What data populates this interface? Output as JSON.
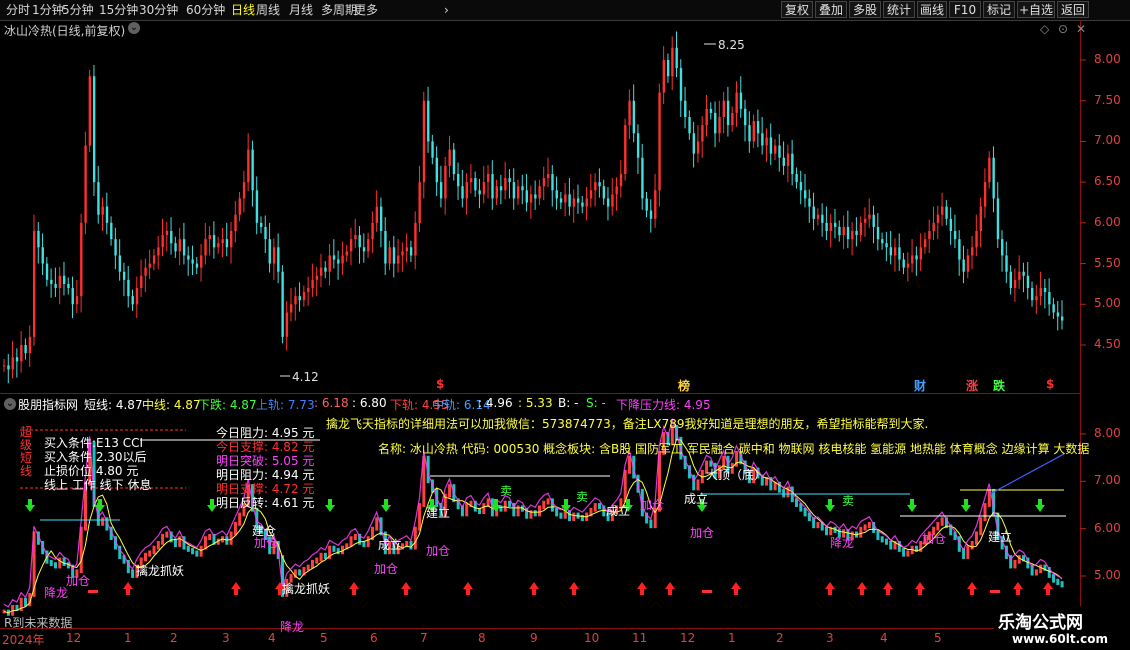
{
  "toolbar": {
    "periods": [
      "分时",
      "1分钟",
      "5分钟",
      "15分钟",
      "30分钟",
      "60分钟",
      "日线",
      "周线",
      "月线",
      "多周期",
      "更多"
    ],
    "active_period": "日线",
    "buttons": [
      "复权",
      "叠加",
      "多股",
      "统计",
      "画线",
      "F10",
      "标记",
      "+自选",
      "返回"
    ]
  },
  "main_pane": {
    "title": "冰山冷热(日线,前复权)",
    "high_label": "8.25",
    "low_label": "4.12",
    "y_ticks": [
      "8.00",
      "7.50",
      "7.00",
      "6.50",
      "6.00",
      "5.50",
      "5.00",
      "4.50"
    ],
    "event_markers": [
      {
        "text": "$",
        "color": "#ff3030"
      },
      {
        "text": "榜",
        "color": "#ffd040"
      },
      {
        "text": "财",
        "color": "#40a0ff"
      },
      {
        "text": "涨",
        "color": "#ff4040"
      },
      {
        "text": "跌",
        "color": "#40ff40"
      },
      {
        "text": "$",
        "color": "#ff3030"
      }
    ],
    "candles_close": [
      4.25,
      4.2,
      4.35,
      4.3,
      4.5,
      4.4,
      4.6,
      5.9,
      5.7,
      5.5,
      5.3,
      5.25,
      5.2,
      5.35,
      5.25,
      5.2,
      5.0,
      5.1,
      6.0,
      6.95,
      7.8,
      6.5,
      6.1,
      6.2,
      6.0,
      5.8,
      5.6,
      5.4,
      5.3,
      5.1,
      5.0,
      5.2,
      5.35,
      5.45,
      5.5,
      5.6,
      5.7,
      5.85,
      5.9,
      5.75,
      5.65,
      5.8,
      5.6,
      5.55,
      5.5,
      5.45,
      5.6,
      5.8,
      5.85,
      5.7,
      5.75,
      5.8,
      5.7,
      5.9,
      6.1,
      6.3,
      6.5,
      6.9,
      6.4,
      6.0,
      5.95,
      5.8,
      5.5,
      5.7,
      5.4,
      4.6,
      4.9,
      5.0,
      5.1,
      5.05,
      5.15,
      5.2,
      5.3,
      5.35,
      5.45,
      5.4,
      5.6,
      5.55,
      5.5,
      5.6,
      5.65,
      5.8,
      5.85,
      5.7,
      5.65,
      5.8,
      6.0,
      6.2,
      5.9,
      5.5,
      5.7,
      5.5,
      5.6,
      5.65,
      5.7,
      5.6,
      6.0,
      6.5,
      7.5,
      7.0,
      6.8,
      6.5,
      6.3,
      6.7,
      6.9,
      6.6,
      6.45,
      6.3,
      6.5,
      6.55,
      6.4,
      6.35,
      6.5,
      6.6,
      6.3,
      6.45,
      6.4,
      6.55,
      6.5,
      6.3,
      6.45,
      6.4,
      6.25,
      6.35,
      6.3,
      6.45,
      6.55,
      6.6,
      6.4,
      6.3,
      6.25,
      6.35,
      6.2,
      6.3,
      6.25,
      6.2,
      6.3,
      6.4,
      6.5,
      6.45,
      6.3,
      6.2,
      6.35,
      6.45,
      6.6,
      7.2,
      7.5,
      7.1,
      6.8,
      6.3,
      6.15,
      6.05,
      6.4,
      7.6,
      8.0,
      7.8,
      8.15,
      7.9,
      7.5,
      7.3,
      7.1,
      6.85,
      7.0,
      7.2,
      7.4,
      7.35,
      7.1,
      7.3,
      7.5,
      7.2,
      7.35,
      7.6,
      7.4,
      7.2,
      7.0,
      7.25,
      7.1,
      6.95,
      7.05,
      6.85,
      6.95,
      6.8,
      6.7,
      6.85,
      6.6,
      6.5,
      6.4,
      6.3,
      6.2,
      6.05,
      6.1,
      6.0,
      5.9,
      6.0,
      5.95,
      5.85,
      5.95,
      5.8,
      5.9,
      5.85,
      6.0,
      6.05,
      6.1,
      5.95,
      5.8,
      5.75,
      5.7,
      5.6,
      5.7,
      5.55,
      5.45,
      5.5,
      5.6,
      5.55,
      5.7,
      5.8,
      5.9,
      6.0,
      6.1,
      6.2,
      6.05,
      5.9,
      5.8,
      5.55,
      5.4,
      5.6,
      5.7,
      5.9,
      6.2,
      6.5,
      6.8,
      6.3,
      5.8,
      5.6,
      5.4,
      5.2,
      5.3,
      5.4,
      5.35,
      5.2,
      5.05,
      5.1,
      5.2,
      5.15,
      5.0,
      4.9,
      4.85,
      4.8
    ]
  },
  "indicator_pane": {
    "title": "股朋指标网",
    "legend": [
      {
        "text": "短线: 4.87",
        "color": "#ffffff"
      },
      {
        "text": "中线: 4.87",
        "color": "#ffff40"
      },
      {
        "text": "下跌: 4.87",
        "color": "#40ff40"
      },
      {
        "text": "上轨: 7.73",
        "color": "#4080ff"
      },
      {
        "text": ": 6.18",
        "color": "#ff6060"
      },
      {
        "text": ": 6.80",
        "color": "#ffffff"
      },
      {
        "text": "下轨: 4.55",
        "color": "#ff4040"
      },
      {
        "text": "中轨: 6.14",
        "color": "#40a0ff"
      },
      {
        "text": ": 4.96",
        "color": "#ffffff"
      },
      {
        "text": ": 5.33",
        "color": "#ffff40"
      },
      {
        "text": "B: -",
        "color": "#ffffff"
      },
      {
        "text": "S: -",
        "color": "#40ff40"
      },
      {
        "text": "下降压力线: 4.95",
        "color": "#ff40ff"
      }
    ],
    "y_ticks": [
      "8.00",
      "7.00",
      "6.00",
      "5.00"
    ],
    "promo_line": "擒龙飞天指标的详细用法可以加我微信：573874773，备注LX789我好知道是理想的朋友，希望指标能帮到大家.",
    "info_line": "名称: 冰山冷热 代码: 000530 概念板块: 含B股 国防军工 军民融合 碳中和 物联网 核电核能 氢能源 地热能 体育概念 边缘计算 大数据",
    "rules": [
      {
        "text": "买入条件:E13 CCI",
        "color": "#ffffff"
      },
      {
        "text": "买入条件 2.30以后",
        "color": "#ffffff"
      },
      {
        "text": "止损价位 4.80 元",
        "color": "#ffffff"
      },
      {
        "text": "线上 工作 线下 休息",
        "color": "#ffffff"
      }
    ],
    "levels": [
      {
        "text": "今日阻力: 4.95 元",
        "color": "#ffffff"
      },
      {
        "text": "今日支撑: 4.82 元",
        "color": "#ff3030"
      },
      {
        "text": "明日突破: 5.05 元",
        "color": "#ff40ff"
      },
      {
        "text": "明日阻力: 4.94 元",
        "color": "#ffffff"
      },
      {
        "text": "明日支撑: 4.72 元",
        "color": "#ff3030"
      },
      {
        "text": "明日反转: 4.61 元",
        "color": "#ffffff"
      }
    ],
    "side_text": "超级短线",
    "annotations": [
      "降龙",
      "加仓",
      "擒龙抓妖",
      "擒龙抓妖",
      "建仓",
      "加仓",
      "建立",
      "加仓",
      "成立",
      "加仓",
      "成立",
      "加仓",
      "大顶（底）",
      "成立",
      "加仓",
      "降龙",
      "卖",
      "卖",
      "卖",
      "加仓",
      "建立",
      "降龙"
    ],
    "footer": "R到未来数据"
  },
  "date_axis": {
    "labels": [
      "2024年",
      "12",
      "1",
      "2",
      "3",
      "4",
      "5",
      "6",
      "7",
      "8",
      "9",
      "10",
      "11",
      "12",
      "1",
      "2",
      "3",
      "4",
      "5"
    ]
  },
  "watermark": {
    "cn": "乐淘公式网",
    "url": "www.60lt.com"
  },
  "colors": {
    "up": "#ff3030",
    "down": "#40e0e0",
    "bg": "#000000",
    "axis": "#c02020"
  }
}
